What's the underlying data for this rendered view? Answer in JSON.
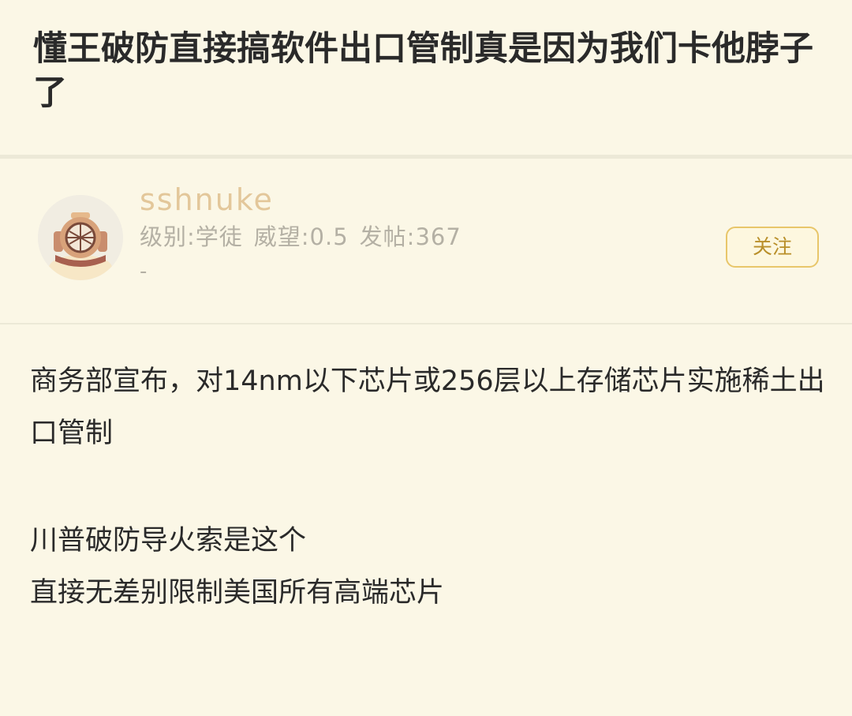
{
  "thread": {
    "title": "懂王破防直接搞软件出口管制真是因为我们卡他脖子了"
  },
  "author": {
    "username": "sshnuke",
    "level": "级别:学徒",
    "reputation": "威望:0.5",
    "posts": "发帖:367",
    "signature": "-",
    "avatar_icon": "diving-helmet-icon",
    "follow_label": "关注"
  },
  "post": {
    "paragraphs": [
      "商务部宣布，对14nm以下芯片或256层以上存储芯片实施稀土出口管制",
      "川普破防导火索是这个",
      "直接无差别限制美国所有高端芯片"
    ]
  },
  "colors": {
    "background": "#fbf7e6",
    "username": "#e3c79a",
    "accent": "#e8c66a",
    "meta_text": "#b4b0a4"
  }
}
